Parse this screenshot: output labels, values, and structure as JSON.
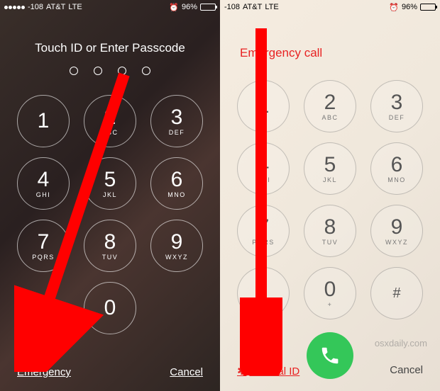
{
  "status": {
    "signal": "-108",
    "carrier": "AT&T",
    "network": "LTE",
    "battery_pct": "96%"
  },
  "lock": {
    "title": "Touch ID or Enter Passcode",
    "keys": [
      {
        "num": "1",
        "letters": ""
      },
      {
        "num": "2",
        "letters": "ABC"
      },
      {
        "num": "3",
        "letters": "DEF"
      },
      {
        "num": "4",
        "letters": "GHI"
      },
      {
        "num": "5",
        "letters": "JKL"
      },
      {
        "num": "6",
        "letters": "MNO"
      },
      {
        "num": "7",
        "letters": "PQRS"
      },
      {
        "num": "8",
        "letters": "TUV"
      },
      {
        "num": "9",
        "letters": "WXYZ"
      },
      {
        "num": "0",
        "letters": ""
      }
    ],
    "emergency": "Emergency",
    "cancel": "Cancel"
  },
  "emergency": {
    "title": "Emergency call",
    "keys": [
      {
        "num": "1",
        "letters": ""
      },
      {
        "num": "2",
        "letters": "ABC"
      },
      {
        "num": "3",
        "letters": "DEF"
      },
      {
        "num": "4",
        "letters": "GHI"
      },
      {
        "num": "5",
        "letters": "JKL"
      },
      {
        "num": "6",
        "letters": "MNO"
      },
      {
        "num": "7",
        "letters": "PQRS"
      },
      {
        "num": "8",
        "letters": "TUV"
      },
      {
        "num": "9",
        "letters": "WXYZ"
      },
      {
        "num": "*",
        "letters": ""
      },
      {
        "num": "0",
        "letters": "+"
      },
      {
        "num": "#",
        "letters": ""
      }
    ],
    "medical_id": "Medical ID",
    "cancel": "Cancel"
  },
  "watermark": "osxdaily.com",
  "colors": {
    "accent_red": "#e82222",
    "call_green": "#34c759"
  }
}
